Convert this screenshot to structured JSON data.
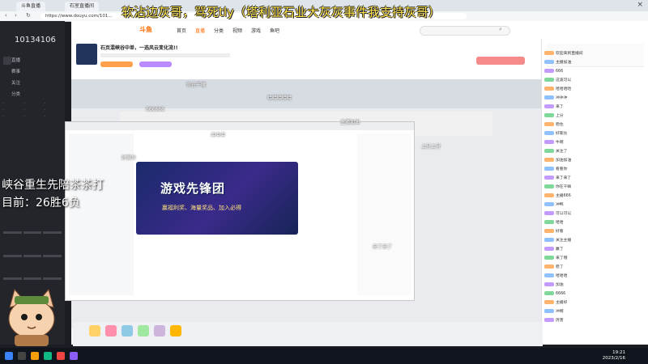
{
  "browser": {
    "tabs": [
      "斗鱼直播",
      "石室直播间"
    ],
    "url": "https://www.douyu.com/101...",
    "close_glyph": "×"
  },
  "overlay": {
    "top_text": "软沾边灰哥，骂死tly（塔利亚石业大灰灰事件我支持灰哥）",
    "left_line1": "峡谷重生先陪茶茶打",
    "left_line2": "目前：26胜6负"
  },
  "sidebar": {
    "room_id": "10134106",
    "items": [
      "直播",
      "赛事",
      "关注",
      "分类"
    ]
  },
  "site": {
    "logo_text": "斗鱼",
    "nav": [
      "首页",
      "直播",
      "分类",
      "视频",
      "游戏",
      "鱼吧"
    ],
    "stream_title": "石页混峡谷中单，一选风云变化流!!"
  },
  "stream": {
    "banner_title": "游戏先锋团",
    "banner_sub": "赢福利奖、海量奖品、加入必得"
  },
  "danmaku": [
    "你在干嘛",
    "哈哈哈哈哈",
    "666666",
    "主播加油",
    "冲冲冲",
    "上分上分",
    "好家伙",
    "来了来了"
  ],
  "chat": {
    "lines": [
      "欢迎来到直播间",
      "主播加油",
      "666",
      "这波可以",
      "哈哈哈哈",
      "冲冲冲",
      "来了",
      "上分",
      "稳住",
      "好家伙",
      "牛啊",
      "关注了",
      "加油加油",
      "看看你",
      "来了来了",
      "你在干嘛",
      "主播666",
      "冲鸭",
      "可以可以",
      "哈哈",
      "好看",
      "关注主播",
      "赢了",
      "来了哦",
      "稳了",
      "哈哈哈",
      "加油",
      "6666",
      "主播好",
      "冲啊",
      "厉害"
    ]
  },
  "taskbar": {
    "time": "19:21",
    "date": "2023/2/16"
  },
  "colors": {
    "overlay_text": "#ffe34d",
    "accent": "#ff6a00"
  }
}
